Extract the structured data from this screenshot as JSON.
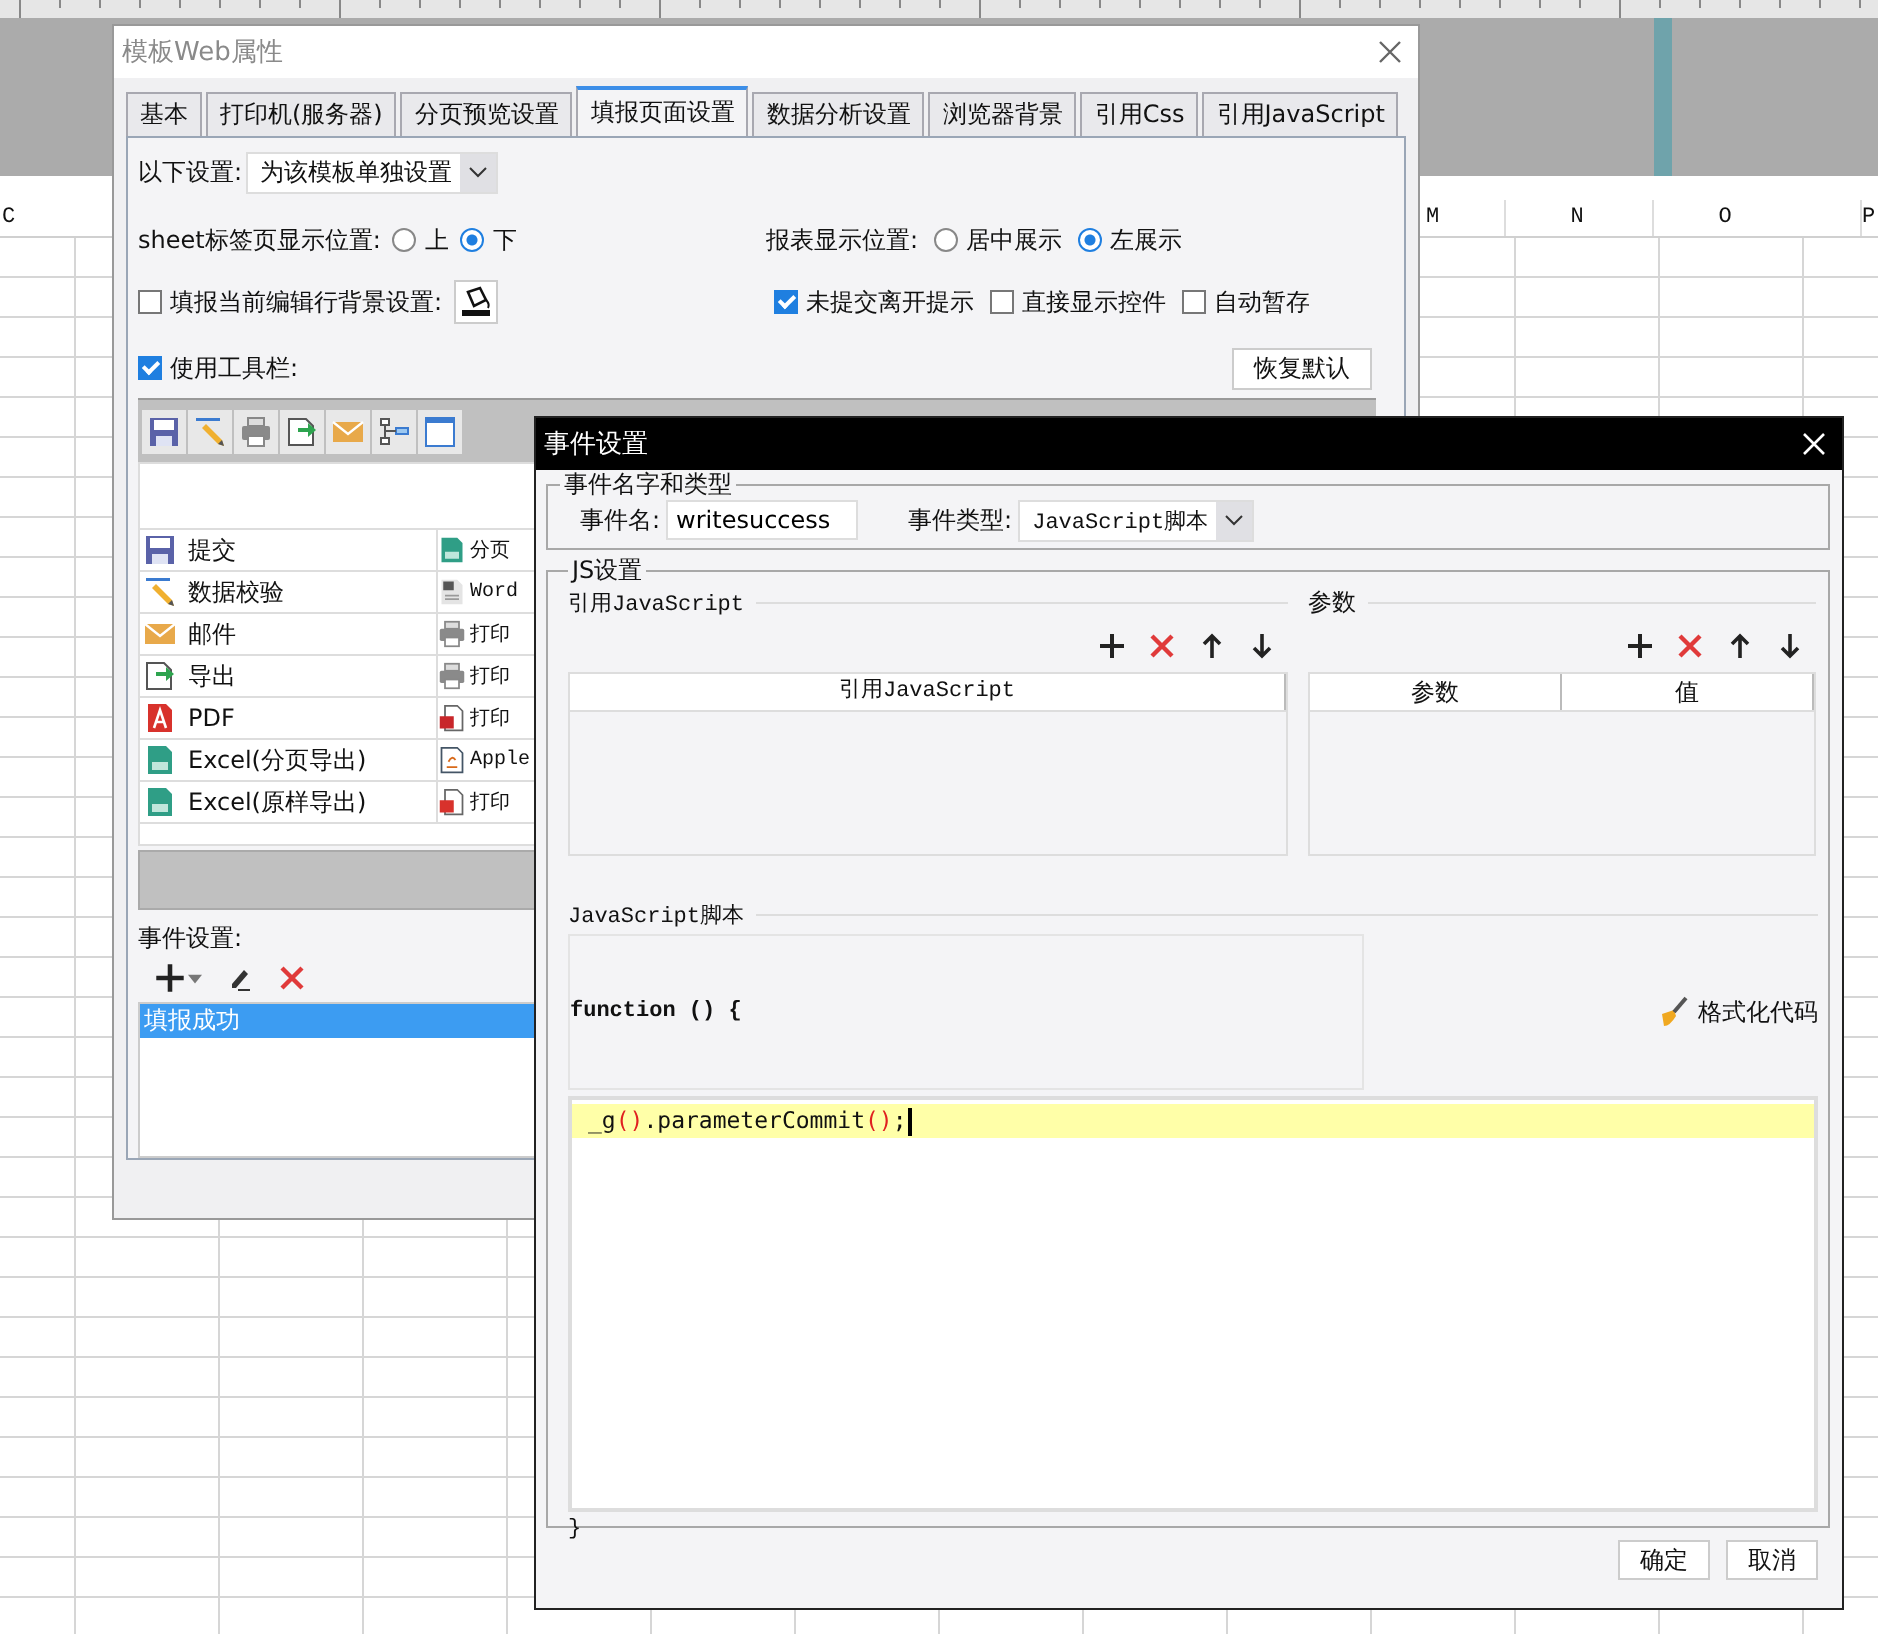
{
  "spreadsheet": {
    "column_headers": [
      "C",
      "M",
      "N",
      "O",
      "P"
    ]
  },
  "template_dialog": {
    "title": "模板Web属性",
    "tabs": [
      {
        "label": "基本",
        "selected": false
      },
      {
        "label": "打印机(服务器)",
        "selected": false
      },
      {
        "label": "分页预览设置",
        "selected": false
      },
      {
        "label": "填报页面设置",
        "selected": true
      },
      {
        "label": "数据分析设置",
        "selected": false
      },
      {
        "label": "浏览器背景",
        "selected": false
      },
      {
        "label": "引用Css",
        "selected": false
      },
      {
        "label": "引用JavaScript",
        "selected": false
      }
    ],
    "scope": {
      "label": "以下设置:",
      "value": "为该模板单独设置"
    },
    "sheet_tab_position": {
      "label": "sheet标签页显示位置:",
      "options": [
        {
          "label": "上",
          "selected": false
        },
        {
          "label": "下",
          "selected": true
        }
      ]
    },
    "report_position": {
      "label": "报表显示位置:",
      "options": [
        {
          "label": "居中展示",
          "selected": false
        },
        {
          "label": "左展示",
          "selected": true
        }
      ]
    },
    "row_background": {
      "label": "填报当前编辑行背景设置:",
      "checked": false
    },
    "options": [
      {
        "label": "未提交离开提示",
        "checked": true
      },
      {
        "label": "直接显示控件",
        "checked": false
      },
      {
        "label": "自动暂存",
        "checked": false
      }
    ],
    "use_toolbar": {
      "label": "使用工具栏:",
      "checked": true
    },
    "restore_button": "恢复默认",
    "toolbar_list": [
      [
        "提交",
        "分页"
      ],
      [
        "数据校验",
        "Word"
      ],
      [
        "邮件",
        "打印"
      ],
      [
        "导出",
        "打印"
      ],
      [
        "PDF",
        "打印"
      ],
      [
        "Excel(分页导出)",
        "Apple"
      ],
      [
        "Excel(原样导出)",
        "打印"
      ]
    ],
    "events": {
      "label": "事件设置:",
      "items": [
        {
          "label": "填报成功",
          "selected": true
        }
      ]
    }
  },
  "event_dialog": {
    "title": "事件设置",
    "name_group": {
      "legend": "事件名字和类型",
      "name_label": "事件名:",
      "name_value": "writesuccess",
      "type_label": "事件类型:",
      "type_value": "JavaScript脚本"
    },
    "js_group": {
      "legend": "JS设置",
      "ref_section": "引用JavaScript",
      "ref_columns": [
        "引用JavaScript"
      ],
      "params_section": "参数",
      "param_columns": [
        "参数",
        "值"
      ],
      "script_label": "JavaScript脚本",
      "function_header": "function () {",
      "format_button": "格式化代码",
      "code_lines": [
        {
          "selected": true,
          "tokens": [
            {
              "kind": "plain",
              "text": "_g"
            },
            {
              "kind": "paren",
              "text": "()"
            },
            {
              "kind": "plain",
              "text": ".parameterCommit"
            },
            {
              "kind": "paren",
              "text": "()"
            },
            {
              "kind": "plain",
              "text": ";"
            }
          ]
        }
      ],
      "closing_brace": "}"
    },
    "buttons": [
      "确定",
      "取消"
    ]
  }
}
